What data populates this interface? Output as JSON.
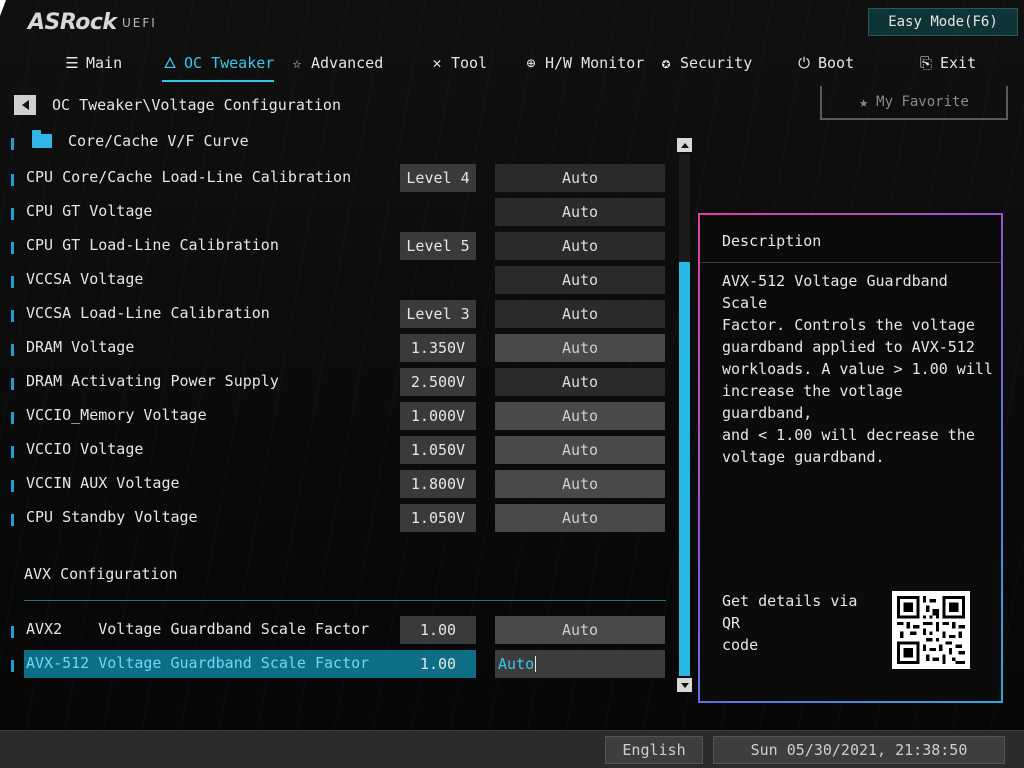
{
  "header": {
    "logo": "ASRock",
    "logo_suffix": "UEFI",
    "easy_mode": "Easy Mode(F6)"
  },
  "nav": {
    "tabs": [
      {
        "label": "Main",
        "icon": "list-icon"
      },
      {
        "label": "OC Tweaker",
        "icon": "flame-icon"
      },
      {
        "label": "Advanced",
        "icon": "star-outline-icon"
      },
      {
        "label": "Tool",
        "icon": "tools-icon"
      },
      {
        "label": "H/W Monitor",
        "icon": "monitor-crosshair-icon"
      },
      {
        "label": "Security",
        "icon": "shield-gear-icon"
      },
      {
        "label": "Boot",
        "icon": "power-icon"
      },
      {
        "label": "Exit",
        "icon": "exit-door-icon"
      }
    ],
    "active_tab": "OC Tweaker"
  },
  "breadcrumb": "OC Tweaker\\Voltage Configuration",
  "favorite_label": "My Favorite",
  "folder_item": "Core/Cache V/F Curve",
  "settings": [
    {
      "label": "CPU Core/Cache Load-Line Calibration",
      "current": "Level 4",
      "value": "Auto"
    },
    {
      "label": "CPU GT Voltage",
      "current": "",
      "value": "Auto"
    },
    {
      "label": "CPU GT Load-Line Calibration",
      "current": "Level 5",
      "value": "Auto"
    },
    {
      "label": "VCCSA Voltage",
      "current": "",
      "value": "Auto"
    },
    {
      "label": "VCCSA Load-Line Calibration",
      "current": "Level 3",
      "value": "Auto"
    },
    {
      "label": "DRAM Voltage",
      "current": "1.350V",
      "value": "Auto"
    },
    {
      "label": "DRAM Activating Power Supply",
      "current": "2.500V",
      "value": "Auto"
    },
    {
      "label": "VCCIO_Memory Voltage",
      "current": "1.000V",
      "value": "Auto"
    },
    {
      "label": "VCCIO Voltage",
      "current": "1.050V",
      "value": "Auto"
    },
    {
      "label": "VCCIN AUX Voltage",
      "current": "1.800V",
      "value": "Auto"
    },
    {
      "label": "CPU Standby Voltage",
      "current": "1.050V",
      "value": "Auto"
    }
  ],
  "avx_section_title": "AVX Configuration",
  "avx_settings": [
    {
      "label": "AVX2    Voltage Guardband Scale Factor",
      "current": "1.00",
      "value": "Auto"
    },
    {
      "label": "AVX-512 Voltage Guardband Scale Factor",
      "current": "1.00",
      "value": "Auto"
    }
  ],
  "description": {
    "title": "Description",
    "text": "AVX-512 Voltage Guardband Scale\nFactor. Controls the voltage\nguardband applied to AVX-512\nworkloads. A value > 1.00 will\nincrease the votlage guardband,\nand < 1.00 will decrease the\nvoltage guardband.",
    "qr_text": "Get details via QR\ncode"
  },
  "footer": {
    "language": "English",
    "datetime": "Sun 05/30/2021, 21:38:50"
  },
  "colors": {
    "accent": "#35c8ea",
    "selected_row": "#0e6e86",
    "scrollbar": "#27b9e6"
  }
}
